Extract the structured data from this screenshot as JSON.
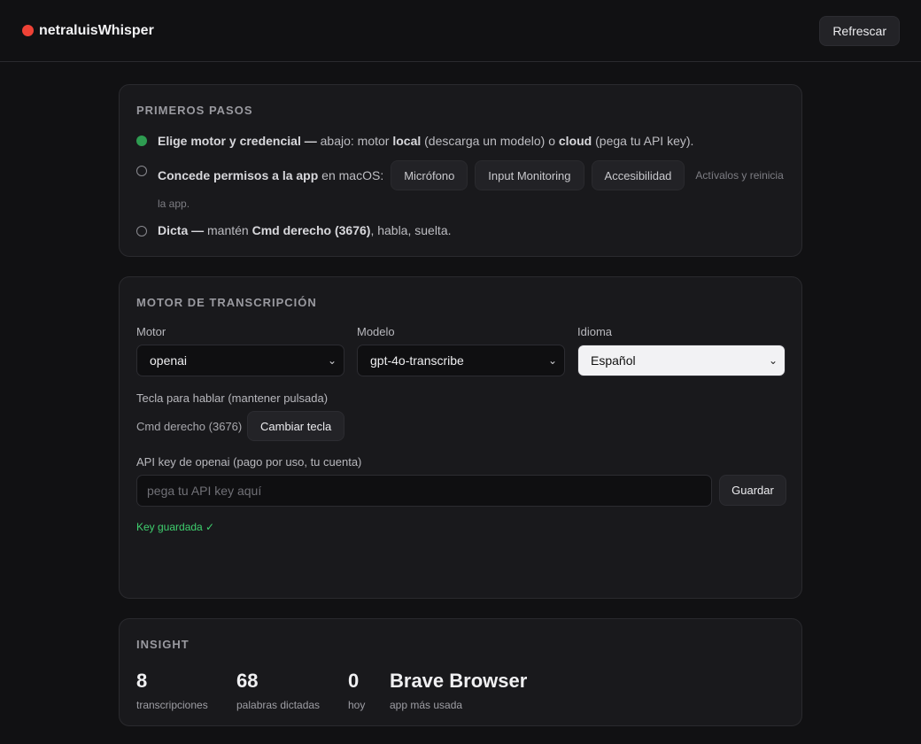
{
  "header": {
    "brand": "netraluisWhisper",
    "refresh_label": "Refrescar"
  },
  "steps": {
    "title": "PRIMEROS PASOS",
    "step1": {
      "bold1": "Elige motor y credencial —",
      "t1": " abajo: motor ",
      "bold2": "local",
      "t2": " (descarga un modelo) o ",
      "bold3": "cloud",
      "t3": " (pega tu API key)."
    },
    "step2": {
      "bold1": "Concede permisos a la app",
      "t1": " en macOS:",
      "buttons": [
        "Micrófono",
        "Input Monitoring",
        "Accesibilidad"
      ],
      "note_line1": "Actívalos y reinicia",
      "note_line2": "la app."
    },
    "step3": {
      "bold1": "Dicta —",
      "t1": " mantén ",
      "bold2": "Cmd derecho (3676)",
      "t2": ", habla, suelta."
    }
  },
  "engine": {
    "title": "MOTOR DE TRANSCRIPCIÓN",
    "motor_label": "Motor",
    "motor_value": "openai",
    "model_label": "Modelo",
    "model_value": "gpt-4o-transcribe",
    "lang_label": "Idioma",
    "lang_value": "Español",
    "hotkey_label": "Tecla para hablar (mantener pulsada)",
    "hotkey_value": "Cmd derecho (3676)",
    "change_key_label": "Cambiar tecla",
    "api_label": "API key de openai (pago por uso, tu cuenta)",
    "api_placeholder": "pega tu API key aquí",
    "save_label": "Guardar",
    "saved_status": "Key guardada ✓"
  },
  "insight": {
    "title": "INSIGHT",
    "stats": [
      {
        "value": "8",
        "label": "transcripciones"
      },
      {
        "value": "68",
        "label": "palabras dictadas"
      },
      {
        "value": "0",
        "label": "hoy"
      },
      {
        "value": "Brave Browser",
        "label": "app más usada"
      }
    ]
  },
  "colors": {
    "brand_dot": "#ef4236",
    "done": "#2e9c51",
    "ok_text": "#3fcf6e"
  }
}
